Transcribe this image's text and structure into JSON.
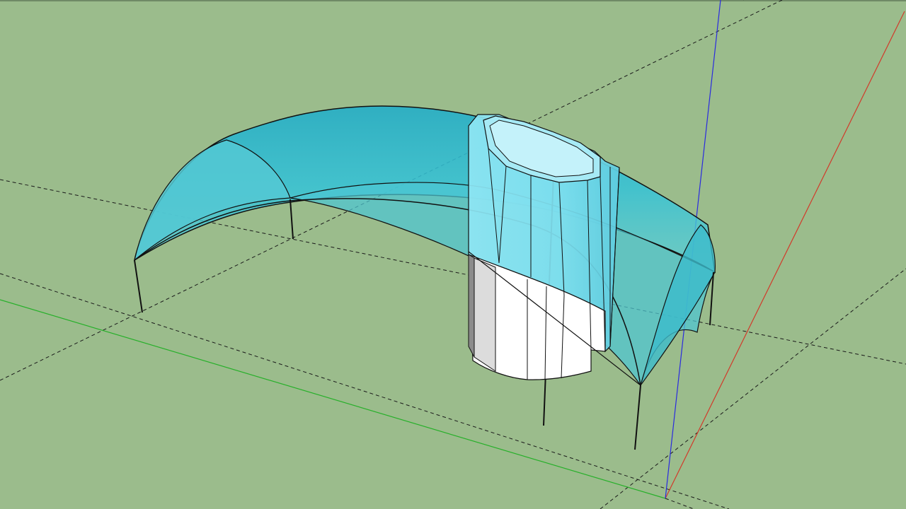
{
  "app": {
    "view": "3d-modeling-viewport",
    "background_color": "#9bbc8c"
  },
  "axes": {
    "red_axis_color": "#d23a2a",
    "green_axis_color": "#27b02a",
    "blue_axis_color": "#2a2ae0",
    "guide_line_color": "#1a1a1a"
  },
  "model": {
    "canopy_color": "#35c0d6",
    "tube_color": "#7ee3f2",
    "solid_white_color": "#ffffff",
    "solid_shadow_color": "#dcdcdc",
    "edge_color": "#111111"
  }
}
